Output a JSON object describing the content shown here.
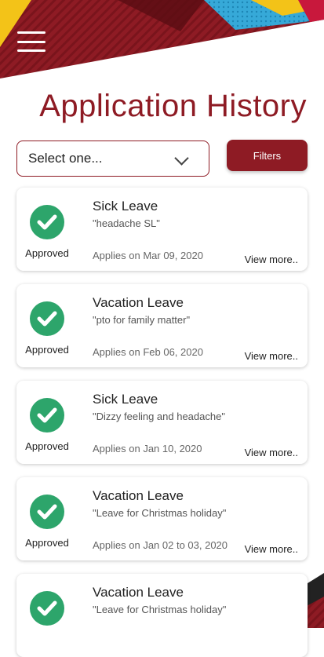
{
  "header": {
    "title": "Application History",
    "menu_icon": "hamburger-menu-icon"
  },
  "controls": {
    "select_value": "Select one...",
    "filters_label": "Filters"
  },
  "colors": {
    "accent": "#8e1b24",
    "approved": "#2da56b"
  },
  "applications": [
    {
      "type": "Sick Leave",
      "reason": "\"headache SL\"",
      "date": "Applies on Mar 09, 2020",
      "status": "Approved",
      "more": "View more.."
    },
    {
      "type": "Vacation Leave",
      "reason": "\"pto for family matter\"",
      "date": "Applies on Feb 06, 2020",
      "status": "Approved",
      "more": "View more.."
    },
    {
      "type": "Sick Leave",
      "reason": "\"Dizzy feeling and headache\"",
      "date": "Applies on Jan 10, 2020",
      "status": "Approved",
      "more": "View more.."
    },
    {
      "type": "Vacation Leave",
      "reason": "\"Leave for Christmas holiday\"",
      "date": "Applies on Jan 02 to 03, 2020",
      "status": "Approved",
      "more": "View more.."
    },
    {
      "type": "Vacation Leave",
      "reason": "\"Leave for Christmas holiday\""
    }
  ]
}
